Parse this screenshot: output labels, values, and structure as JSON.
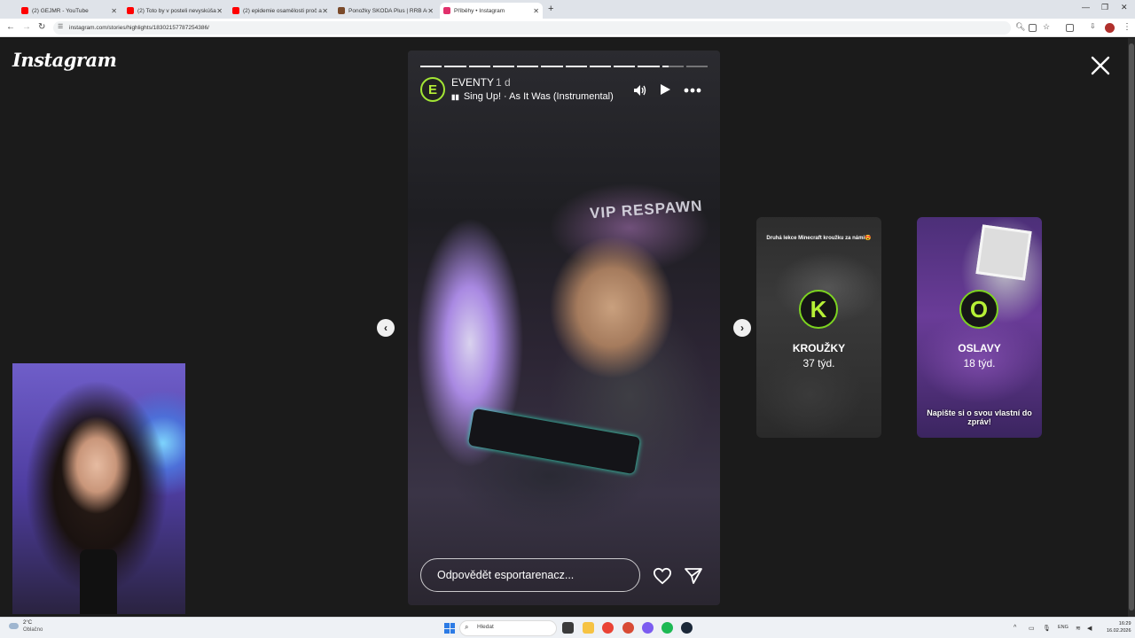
{
  "browser": {
    "tabs": [
      {
        "title": "(2) GEJMR - YouTube",
        "favicon": "youtube-icon",
        "color": "#ff0000",
        "active": false
      },
      {
        "title": "(2) Toto by v posteli nevyskúšal",
        "favicon": "youtube-icon",
        "color": "#ff0000",
        "active": false
      },
      {
        "title": "(2) epidemie osamělosti proč a",
        "favicon": "youtube-icon",
        "color": "#ff0000",
        "active": false
      },
      {
        "title": "Ponožky ŠKODA Plus | RRB Auto",
        "favicon": "shop-icon",
        "color": "#7a4a2a",
        "active": false
      },
      {
        "title": "Příběhy • Instagram",
        "favicon": "instagram-icon",
        "color": "#e1306c",
        "active": true
      }
    ],
    "url": "instagram.com/stories/highlights/18302157787254386/"
  },
  "instagram": {
    "logo": "Instagram",
    "story": {
      "username": "EVENTY",
      "avatar_letter": "E",
      "time": "1 d",
      "music": "Sing Up! · As It Was (Instrumental)",
      "sign_text": "VIP RESPAWN",
      "reply_placeholder": "Odpovědět esportarenacz...",
      "segments_total": 12,
      "segments_viewed": 10,
      "current_segment_progress": 0.3
    },
    "highlights": [
      {
        "letter": "K",
        "name": "KROUŽKY",
        "age": "37 týd.",
        "caption": "Druhá lekce Minecraft kroužku za námi😍"
      },
      {
        "letter": "O",
        "name": "OSLAVY",
        "age": "18 týd.",
        "caption": "Napište si o svou vlastní do zpráv!"
      }
    ]
  },
  "taskbar": {
    "weather_temp": "2°C",
    "weather_desc": "Oblačno",
    "search_placeholder": "Hledat",
    "language": "ENG",
    "time": "16:29",
    "date": "16.02.2026"
  }
}
